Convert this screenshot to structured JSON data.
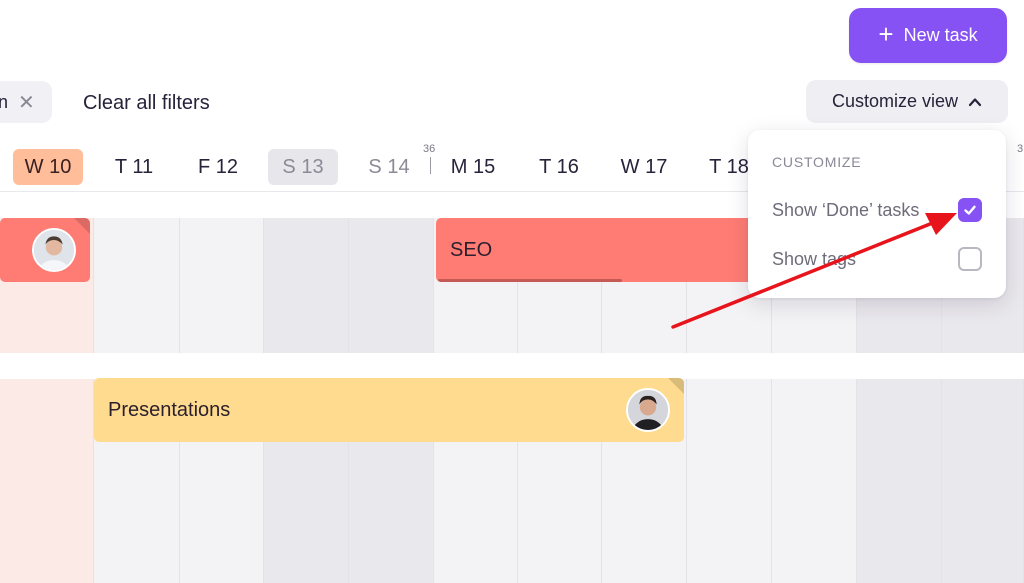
{
  "toolbar": {
    "new_task_label": "New task",
    "new_task_icon": "plus-icon",
    "filter_chip_text": "n",
    "filter_chip_remove_icon": "close-icon",
    "clear_filters_label": "Clear all filters",
    "customize_label": "Customize view",
    "customize_icon": "chevron-up-icon"
  },
  "timeline": {
    "week_numbers": [
      "36",
      "3"
    ],
    "days": [
      {
        "label": "W 10",
        "state": "today"
      },
      {
        "label": "T 11",
        "state": "normal"
      },
      {
        "label": "F 12",
        "state": "normal"
      },
      {
        "label": "S 13",
        "state": "weekend-highlight"
      },
      {
        "label": "S 14",
        "state": "weekend"
      },
      {
        "label": "M 15",
        "state": "normal"
      },
      {
        "label": "T 16",
        "state": "normal"
      },
      {
        "label": "W 17",
        "state": "normal"
      },
      {
        "label": "T 18",
        "state": "normal"
      }
    ]
  },
  "tasks": [
    {
      "name": "",
      "color": "#fe7c74",
      "has_avatar": true
    },
    {
      "name": "SEO",
      "color": "#fe7c74",
      "progress_percent": 56
    },
    {
      "name": "Presentations",
      "color": "#fedb8e",
      "has_avatar": true
    }
  ],
  "customize_menu": {
    "section_title": "CUSTOMIZE",
    "options": [
      {
        "label": "Show ‘Done’ tasks",
        "checked": true
      },
      {
        "label": "Show tags",
        "checked": false
      }
    ]
  },
  "colors": {
    "accent": "#8652f4",
    "today": "#ffbd9a",
    "task_red": "#fe7c74",
    "task_yellow": "#fedb8e",
    "annotation_arrow": "#e8141c"
  }
}
